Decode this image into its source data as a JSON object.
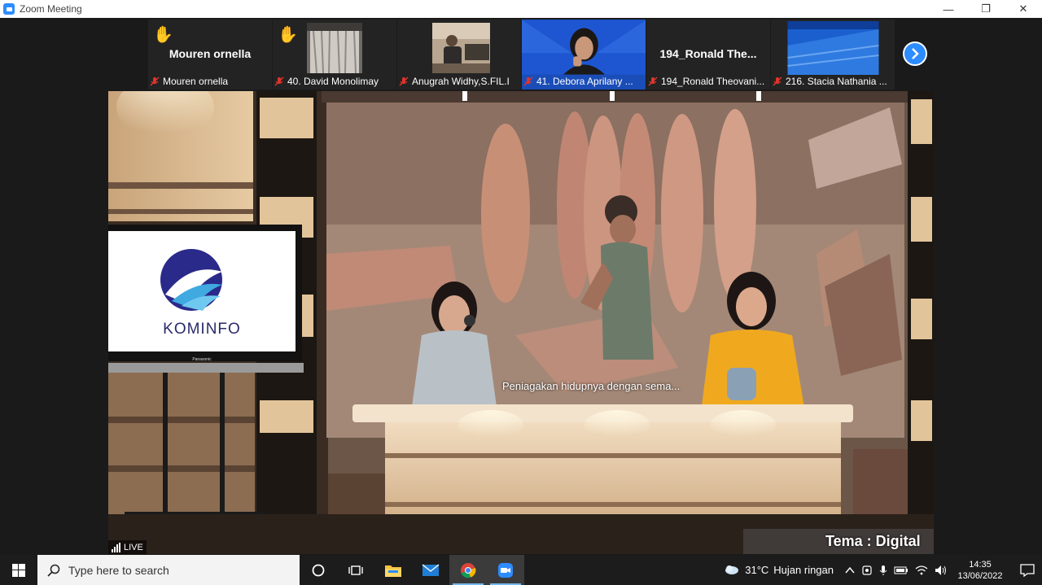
{
  "window": {
    "title": "Zoom Meeting",
    "minimize": "—",
    "restore": "❐",
    "close": "✕"
  },
  "participants": [
    {
      "display": "Mouren ornella",
      "label": "Mouren ornella",
      "hand": true,
      "type": "name"
    },
    {
      "display": "",
      "label": "40. David Monolimay",
      "hand": true,
      "type": "curtain"
    },
    {
      "display": "",
      "label": "Anugrah Widhy,S.FIL.I",
      "hand": false,
      "type": "room"
    },
    {
      "display": "",
      "label": "41. Debora Aprilany ...",
      "hand": false,
      "type": "person"
    },
    {
      "display": "194_Ronald The...",
      "label": "194_Ronald Theovani...",
      "hand": false,
      "type": "name"
    },
    {
      "display": "",
      "label": "216. Stacia Nathania ...",
      "hand": false,
      "type": "blue"
    }
  ],
  "stage": {
    "logo_text": "KOMINFO",
    "monitor_brand": "Panasonic",
    "caption": "Peniagakan hidupnya dengan sema...",
    "live_label": "LIVE",
    "tema_label": "Tema : Digital"
  },
  "taskbar": {
    "search_placeholder": "Type here to search",
    "weather_temp": "31°C",
    "weather_desc": "Hujan ringan",
    "time": "14:35",
    "date": "13/06/2022"
  },
  "colors": {
    "zoom_blue": "#2d8cff",
    "muted_red": "#e0352b",
    "hand_yellow": "#f2b01e"
  }
}
